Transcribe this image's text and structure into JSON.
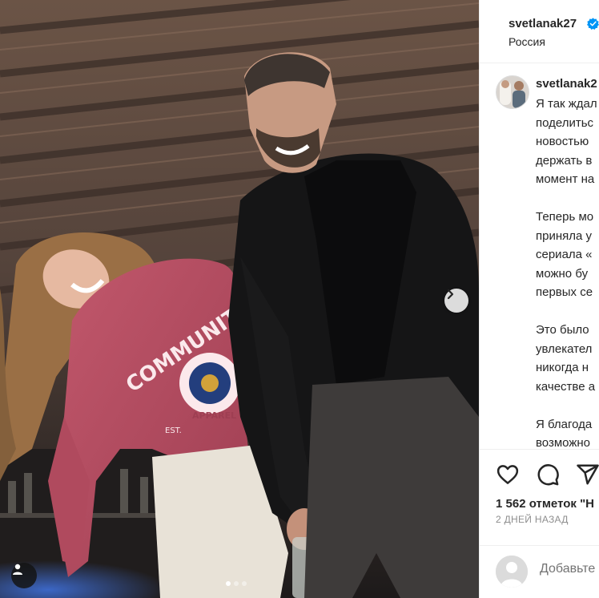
{
  "post": {
    "image_alt": "",
    "carousel": {
      "total": 3,
      "active": 0
    }
  },
  "header": {
    "username": "svetlanak27",
    "location": "Россия",
    "verified": true
  },
  "caption": {
    "username": "svetlanak2",
    "paragraphs": [
      "Я так ждал\nподелитьс\nновостью\nдержать в\nмомент на",
      "Теперь мо\nприняла у\nсериала «\nможно бу\nпервых се",
      "Это было\nувлекател\nникогда н\nкачестве а",
      "Я благода\nвозможно\nсъемочно"
    ]
  },
  "actions": {
    "like_icon": "heart-icon",
    "comment_icon": "comment-icon",
    "share_icon": "share-icon"
  },
  "stats": {
    "likes": "1 562 отметок \"Н",
    "time_ago": "2 ДНЕЙ НАЗАД"
  },
  "comment": {
    "placeholder": "Добавьте"
  },
  "colors": {
    "verified": "#0095f6",
    "text": "#262626",
    "muted": "#8e8e8e",
    "border": "#efefef"
  }
}
